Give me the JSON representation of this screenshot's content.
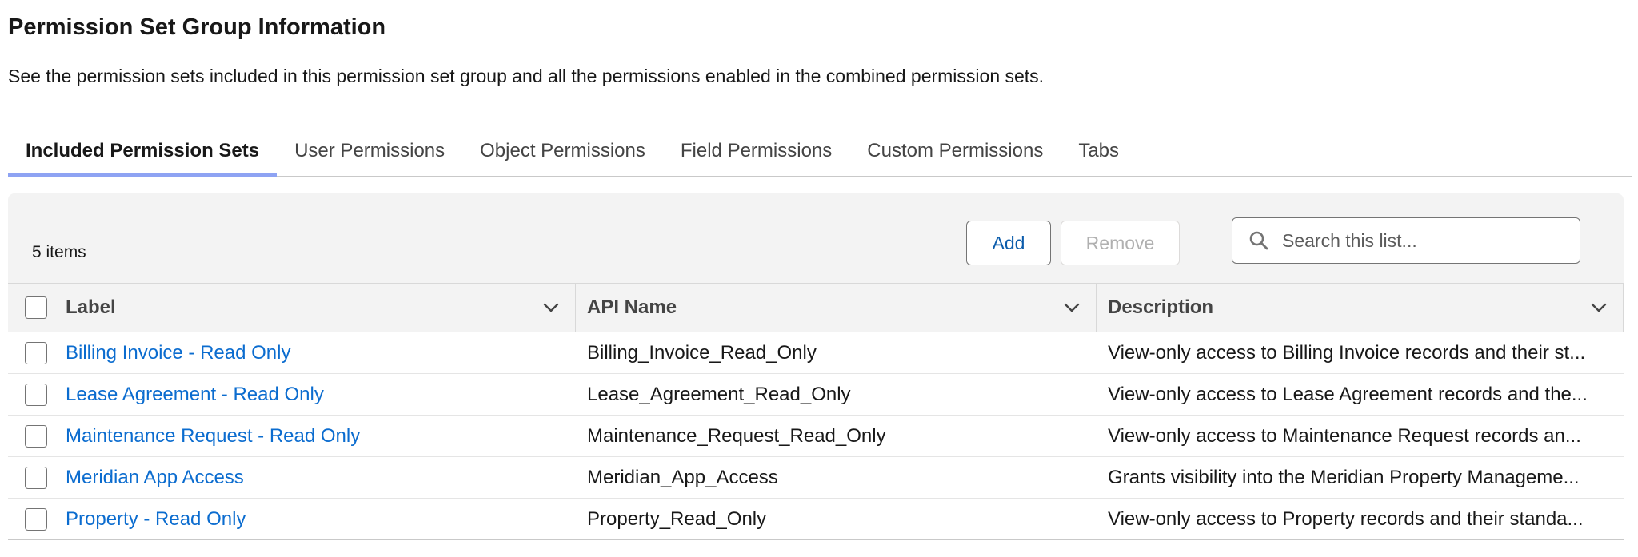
{
  "header": {
    "title": "Permission Set Group Information",
    "subtitle": "See the permission sets included in this permission set group and all the permissions enabled in the combined permission sets."
  },
  "tabs": [
    {
      "label": "Included Permission Sets",
      "active": true
    },
    {
      "label": "User Permissions",
      "active": false
    },
    {
      "label": "Object Permissions",
      "active": false
    },
    {
      "label": "Field Permissions",
      "active": false
    },
    {
      "label": "Custom Permissions",
      "active": false
    },
    {
      "label": "Tabs",
      "active": false
    }
  ],
  "list": {
    "count_label": "5 items",
    "add_label": "Add",
    "remove_label": "Remove",
    "search_placeholder": "Search this list...",
    "search_value": ""
  },
  "table": {
    "columns": [
      {
        "label": "Label"
      },
      {
        "label": "API Name"
      },
      {
        "label": "Description"
      }
    ],
    "rows": [
      {
        "label": "Billing Invoice - Read Only",
        "api_name": "Billing_Invoice_Read_Only",
        "description": "View-only access to Billing Invoice records and their st..."
      },
      {
        "label": "Lease Agreement - Read Only",
        "api_name": "Lease_Agreement_Read_Only",
        "description": "View-only access to Lease Agreement records and the..."
      },
      {
        "label": "Maintenance Request - Read Only",
        "api_name": "Maintenance_Request_Read_Only",
        "description": "View-only access to Maintenance Request records an..."
      },
      {
        "label": "Meridian App Access",
        "api_name": "Meridian_App_Access",
        "description": "Grants visibility into the Meridian Property Manageme..."
      },
      {
        "label": "Property - Read Only",
        "api_name": "Property_Read_Only",
        "description": "View-only access to Property records and their standa..."
      }
    ]
  },
  "colors": {
    "link": "#0b6ccf",
    "active_tab_underline": "#8ea3f3",
    "add_button_text": "#0b5cab",
    "disabled_text": "#b0b0b0"
  },
  "icons": {
    "search": "search-icon",
    "column_menu": "chevron-down-icon"
  }
}
